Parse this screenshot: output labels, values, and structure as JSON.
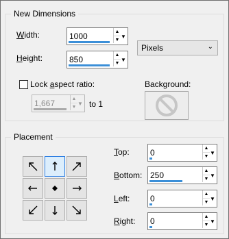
{
  "new_dimensions": {
    "title": "New Dimensions",
    "width_label": "Width:",
    "width_value": "1000",
    "height_label": "Height:",
    "height_value": "850",
    "units": "Pixels",
    "lock_aspect_label": "Lock aspect ratio:",
    "lock_aspect_checked": false,
    "aspect_value": "1,667",
    "aspect_suffix": "to 1",
    "background_label": "Background:",
    "background_icon": "no-symbol-icon"
  },
  "placement": {
    "title": "Placement",
    "top_label": "Top:",
    "top_value": "0",
    "bottom_label": "Bottom:",
    "bottom_value": "250",
    "left_label": "Left:",
    "left_value": "0",
    "right_label": "Right:",
    "right_value": "0",
    "anchor_buttons": [
      "arrow-up-left-icon",
      "arrow-up-icon",
      "arrow-up-right-icon",
      "arrow-left-icon",
      "center-dot-icon",
      "arrow-right-icon",
      "arrow-down-left-icon",
      "arrow-down-icon",
      "arrow-down-right-icon"
    ],
    "selected_anchor": "arrow-up-icon"
  },
  "colors": {
    "accent": "#3b8fd8",
    "selected_anchor_border": "#2b7de1"
  }
}
